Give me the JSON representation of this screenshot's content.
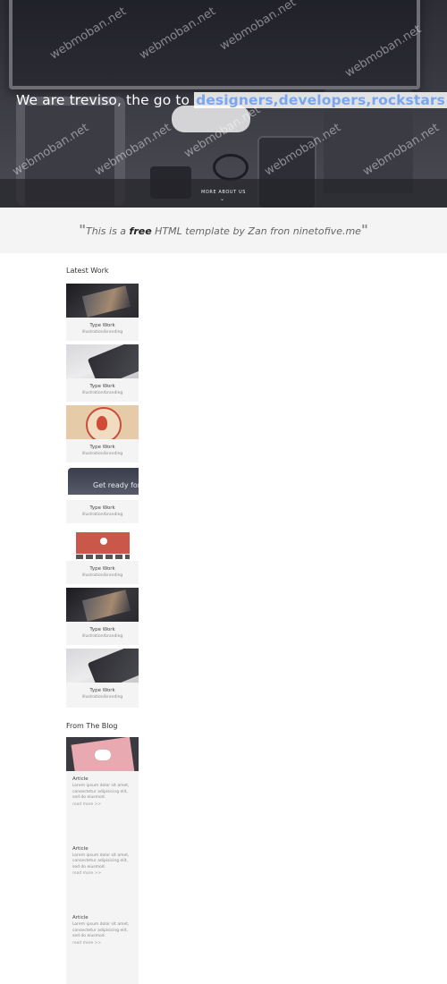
{
  "hero": {
    "headline_prefix": "We are treviso, the go to",
    "headline_highlight": "designers,developers,rockstars",
    "headline_suffix": ".",
    "cta_label": "MORE ABOUT US",
    "watermark": "webmoban.net"
  },
  "quote": {
    "open_mark": "\"",
    "text_before": "This is a ",
    "text_bold": "free",
    "text_after": " HTML template by Zan fron ninetofive.me",
    "close_mark": "\""
  },
  "latest_work": {
    "title": "Latest Work",
    "items": [
      {
        "title": "Type Work",
        "subtitle": "illustration/branding",
        "image": "photo-camera-dark"
      },
      {
        "title": "Type Work",
        "subtitle": "illustration/branding",
        "image": "photo-tablet-light"
      },
      {
        "title": "Type Work",
        "subtitle": "illustration/branding",
        "image": "badge-illustration"
      },
      {
        "title": "Type Work",
        "subtitle": "illustration/branding",
        "image": "web-screenshot",
        "image_text": "Get ready for"
      },
      {
        "title": "Type Work",
        "subtitle": "illustration/branding",
        "image": "red-website-mockup"
      },
      {
        "title": "Type Work",
        "subtitle": "illustration/branding",
        "image": "photo-camera-dark"
      },
      {
        "title": "Type Work",
        "subtitle": "illustration/branding",
        "image": "photo-tablet-light"
      }
    ]
  },
  "blog": {
    "title": "From The Blog",
    "items": [
      {
        "title": "Article",
        "body": "Lorem ipsum dolor sit amet, consectetur adipisicing elit, sed do eiusmod.",
        "more": "read more >>",
        "image": "pink-cloud-card"
      },
      {
        "title": "Article",
        "body": "Lorem ipsum dolor sit amet, consectetur adipisicing elit, sed do eiusmod.",
        "more": "read more >>"
      },
      {
        "title": "Article",
        "body": "Lorem ipsum dolor sit amet, consectetur adipisicing elit, sed do eiusmod.",
        "more": "read more >>"
      }
    ]
  }
}
